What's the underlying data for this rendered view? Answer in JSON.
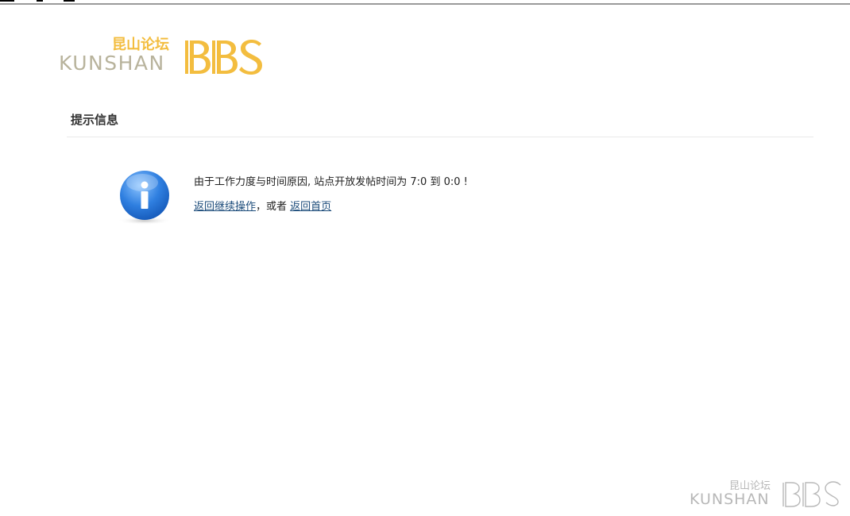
{
  "header": {
    "logo_cn": "昆山论坛",
    "logo_en": "KUNSHAN",
    "logo_bbs": "BBS"
  },
  "notice": {
    "title": "提示信息",
    "message": "由于工作力度与时间原因, 站点开放发帖时间为 7:0 到 0:0 !",
    "back_link": "返回继续操作",
    "separator": "，或者",
    "home_link": "返回首页"
  },
  "footer": {
    "logo_cn": "昆山论坛",
    "logo_en": "KUNSHAN",
    "logo_bbs": "BBS"
  },
  "colors": {
    "logo_gold": "#f3bd3f",
    "logo_gray": "#b8b39c",
    "link": "#1b4b7a",
    "info_blue": "#2f7fe0"
  },
  "icons": {
    "notice": "info-icon"
  }
}
